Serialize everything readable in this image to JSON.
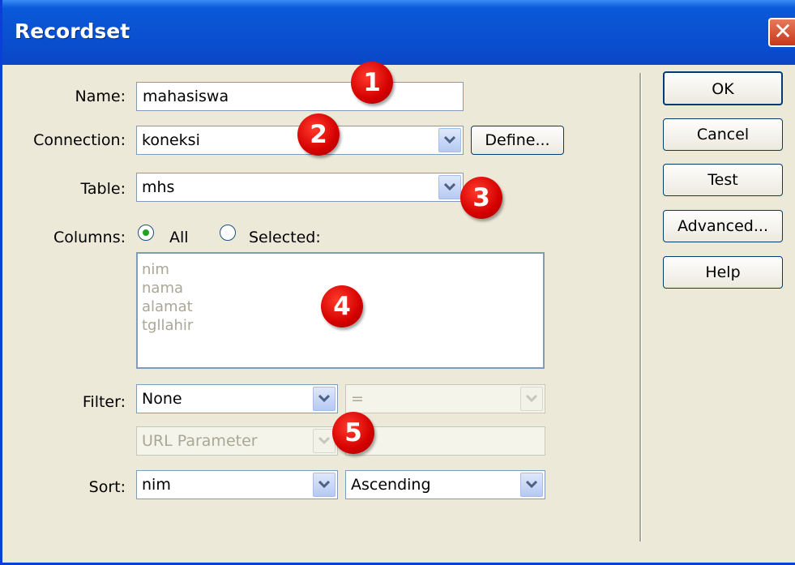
{
  "window": {
    "title": "Recordset"
  },
  "form": {
    "name": {
      "label": "Name:",
      "value": "mahasiswa"
    },
    "connection": {
      "label": "Connection:",
      "value": "koneksi",
      "define_label": "Define..."
    },
    "table": {
      "label": "Table:",
      "value": "mhs"
    },
    "columns": {
      "label": "Columns:",
      "option_all": "All",
      "option_selected": "Selected:",
      "selected_option": "All",
      "items": [
        "nim",
        "nama",
        "alamat",
        "tgllahir"
      ]
    },
    "filter": {
      "label": "Filter:",
      "column_value": "None",
      "operator_value": "=",
      "param_type_value": "URL Parameter",
      "param_value": ""
    },
    "sort": {
      "label": "Sort:",
      "column_value": "nim",
      "order_value": "Ascending"
    }
  },
  "buttons": {
    "ok": "OK",
    "cancel": "Cancel",
    "test": "Test",
    "advanced": "Advanced...",
    "help": "Help"
  },
  "annotations": [
    "1",
    "2",
    "3",
    "4",
    "5"
  ],
  "colors": {
    "titlebar": "#0a4fd0",
    "badge": "#d40000",
    "face": "#ece9d8"
  },
  "icons": {
    "close": "close-icon",
    "dropdown": "chevron-down-icon"
  }
}
